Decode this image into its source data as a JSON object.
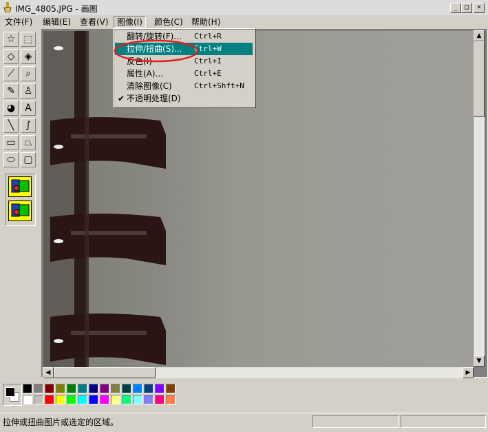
{
  "window": {
    "title": "IMG_4805.JPG - 画图"
  },
  "title_buttons": {
    "minimize": "_",
    "maximize": "□",
    "close": "×"
  },
  "menubar": [
    {
      "label": "文件(F)"
    },
    {
      "label": "编辑(E)"
    },
    {
      "label": "查看(V)"
    },
    {
      "label": "图像(I)"
    },
    {
      "label": "颜色(C)"
    },
    {
      "label": "帮助(H)"
    }
  ],
  "image_menu": {
    "items": [
      {
        "label": "翻转/旋转(F)...",
        "shortcut": "Ctrl+R"
      },
      {
        "label": "拉伸/扭曲(S)...",
        "shortcut": "Ctrl+W"
      },
      {
        "label": "反色(I)",
        "shortcut": "Ctrl+I"
      },
      {
        "label": "属性(A)...",
        "shortcut": "Ctrl+E"
      },
      {
        "label": "清除图像(C)",
        "shortcut": "Ctrl+Shft+N"
      },
      {
        "label": "不透明处理(D)",
        "shortcut": "",
        "checked": true,
        "check_mark": "✔"
      }
    ],
    "highlighted_index": 1
  },
  "tools": [
    {
      "icon": "free-select-icon",
      "glyph": "☆"
    },
    {
      "icon": "rect-select-icon",
      "glyph": "⬚"
    },
    {
      "icon": "eraser-icon",
      "glyph": "◇"
    },
    {
      "icon": "fill-bucket-icon",
      "glyph": "◈"
    },
    {
      "icon": "color-picker-icon",
      "glyph": "⟋"
    },
    {
      "icon": "magnifier-icon",
      "glyph": "⌕"
    },
    {
      "icon": "pencil-icon",
      "glyph": "✎"
    },
    {
      "icon": "brush-icon",
      "glyph": "♙"
    },
    {
      "icon": "airbrush-icon",
      "glyph": "◕"
    },
    {
      "icon": "text-icon",
      "glyph": "A"
    },
    {
      "icon": "line-icon",
      "glyph": "╲"
    },
    {
      "icon": "curve-icon",
      "glyph": "∫"
    },
    {
      "icon": "rectangle-icon",
      "glyph": "▭"
    },
    {
      "icon": "polygon-icon",
      "glyph": "⏢"
    },
    {
      "icon": "ellipse-icon",
      "glyph": "⬭"
    },
    {
      "icon": "rounded-rect-icon",
      "glyph": "▢"
    }
  ],
  "palette": {
    "foreground": "#000000",
    "background": "#ffffff",
    "row1": [
      "#000000",
      "#808080",
      "#800000",
      "#808000",
      "#008000",
      "#008080",
      "#000080",
      "#800080",
      "#808040",
      "#004040",
      "#0080ff",
      "#004080",
      "#8000ff",
      "#804000"
    ],
    "row2": [
      "#ffffff",
      "#c0c0c0",
      "#ff0000",
      "#ffff00",
      "#00ff00",
      "#00ffff",
      "#0000ff",
      "#ff00ff",
      "#ffff80",
      "#00ff80",
      "#80ffff",
      "#8080ff",
      "#ff0080",
      "#ff8040"
    ]
  },
  "statusbar": {
    "message": "拉伸或扭曲图片或选定的区域。"
  },
  "colors": {
    "menu_highlight": "#008080",
    "annotation": "#e02020"
  }
}
